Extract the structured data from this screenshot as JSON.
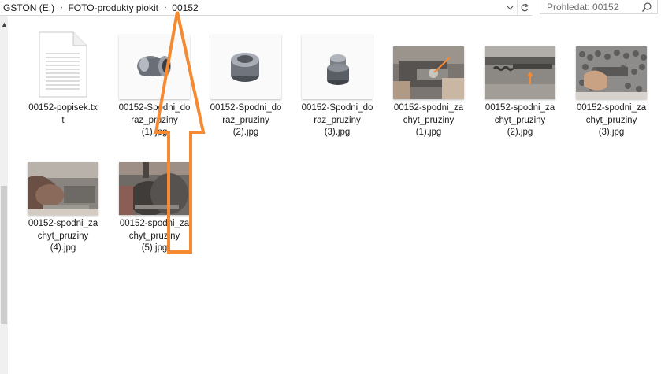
{
  "breadcrumb": {
    "drive": "GSTON (E:)",
    "folder": "FOTO-produkty piokit",
    "current": "00152",
    "separator": "›"
  },
  "search": {
    "placeholder": "Prohledat: 00152"
  },
  "files": [
    {
      "name": "00152-popisek.txt",
      "type": "text-document"
    },
    {
      "name": "00152-Spodni_doraz_pruziny (1).jpg",
      "type": "image"
    },
    {
      "name": "00152-Spodni_doraz_pruziny (2).jpg",
      "type": "image"
    },
    {
      "name": "00152-Spodni_doraz_pruziny (3).jpg",
      "type": "image"
    },
    {
      "name": "00152-spodni_zachyt_pruziny (1).jpg",
      "type": "image"
    },
    {
      "name": "00152-spodni_zachyt_pruziny (2).jpg",
      "type": "image"
    },
    {
      "name": "00152-spodni_zachyt_pruziny (3).jpg",
      "type": "image"
    },
    {
      "name": "00152-spodni_zachyt_pruziny (4).jpg",
      "type": "image"
    },
    {
      "name": "00152-spodni_zachyt_pruziny (5).jpg",
      "type": "image"
    }
  ],
  "labels": [
    [
      "00152-popisek.tx",
      "t"
    ],
    [
      "00152-Spodni_do",
      "raz_pruziny",
      "(1).jpg"
    ],
    [
      "00152-Spodni_do",
      "raz_pruziny",
      "(2).jpg"
    ],
    [
      "00152-Spodni_do",
      "raz_pruziny",
      "(3).jpg"
    ],
    [
      "00152-spodni_za",
      "chyt_pruziny",
      "(1).jpg"
    ],
    [
      "00152-spodni_za",
      "chyt_pruziny",
      "(2).jpg"
    ],
    [
      "00152-spodni_za",
      "chyt_pruziny",
      "(3).jpg"
    ],
    [
      "00152-spodni_za",
      "chyt_pruziny",
      "(4).jpg"
    ],
    [
      "00152-spodni_za",
      "chyt_pruziny",
      "(5).jpg"
    ]
  ],
  "colors": {
    "annotation_arrow": "#f58a33",
    "selection": "#cce8ff"
  },
  "icons": {
    "dropdown": "chevron-down-icon",
    "refresh": "refresh-icon",
    "search": "search-icon"
  }
}
